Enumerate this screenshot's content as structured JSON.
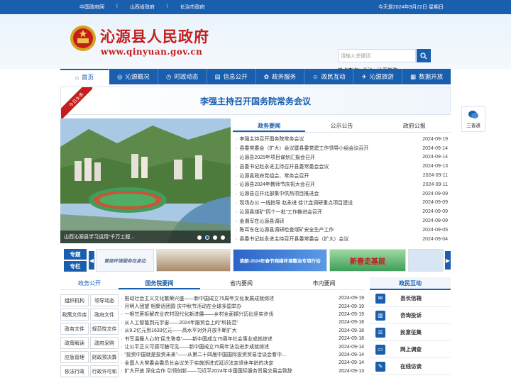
{
  "topbar": {
    "links": [
      "中国政府网",
      "山西省政府",
      "长治市政府"
    ],
    "separator": "|",
    "date": "今天是2024年9月22日 星期日"
  },
  "header": {
    "title": "沁源县人民政府",
    "url": "www.qinyuan.gov.cn",
    "search_placeholder": "请输入关键词",
    "hot_search": "热点查询：长治、沁源旅游"
  },
  "nav": {
    "items": [
      {
        "label": "首页",
        "icon": "home-icon"
      },
      {
        "label": "沁源概况",
        "icon": "globe-icon"
      },
      {
        "label": "时政动态",
        "icon": "clock-icon"
      },
      {
        "label": "信息公开",
        "icon": "doc-icon"
      },
      {
        "label": "政务服务",
        "icon": "service-icon"
      },
      {
        "label": "政民互动",
        "icon": "people-icon"
      },
      {
        "label": "沁源旅游",
        "icon": "travel-icon"
      },
      {
        "label": "数据开放",
        "icon": "data-icon"
      }
    ]
  },
  "headline": {
    "ribbon": "今日头条",
    "text": "李强主持召开国务院常务会议"
  },
  "slider": {
    "caption": "山西沁源县学习运用“千万工程..."
  },
  "news_tabs": [
    "政务要闻",
    "公示公告",
    "政府公报"
  ],
  "news": [
    {
      "title": "李强主持召开国务院常务会议",
      "date": "2024-09-19"
    },
    {
      "title": "县委常委会（扩大）会议暨县委党建工作领导小组会议召开",
      "date": "2024-09-14"
    },
    {
      "title": "沁源县2025年项目谋划汇报会召开",
      "date": "2024-09-14"
    },
    {
      "title": "县委书记赵永进主持召开县委常委会会议",
      "date": "2024-09-13"
    },
    {
      "title": "沁源县政府党组会、常务会召开",
      "date": "2024-09-11"
    },
    {
      "title": "沁源县2024年教师节庆祝大会召开",
      "date": "2024-09-11"
    },
    {
      "title": "沁源县召开北部集中供热项目推进会",
      "date": "2024-09-09"
    },
    {
      "title": "现场办公 一线指导 赵永进 徐计连调研重点项目建设",
      "date": "2024-09-09"
    },
    {
      "title": "沁源县煤矿“四个一批”工作推进会召开",
      "date": "2024-09-09"
    },
    {
      "title": "金湘军在沁源县调研",
      "date": "2024-09-09"
    },
    {
      "title": "陈耳东在沁源县调研检查煤矿安全生产工作",
      "date": "2024-09-05"
    },
    {
      "title": "县委书记赵永进主持召开县委常委会（扩大）会议",
      "date": "2024-09-04"
    }
  ],
  "side_float": {
    "label": "三晋通"
  },
  "banners": {
    "zt_labels": [
      "专",
      "题",
      "专",
      "栏"
    ],
    "prev": "◀",
    "next": "▶",
    "items": [
      "营商环境服务在身边",
      "",
      "清朗·2024年春节网络环境整治专项行动",
      "新春走基层",
      ""
    ]
  },
  "section_tabs": [
    "政务公开",
    "国务院要闻",
    "省内要闻",
    "市内要闻"
  ],
  "gov_grid": [
    [
      "组织机构",
      "领导动态"
    ],
    [
      "政策文件库",
      "政府文件"
    ],
    [
      "政务文件",
      "规范性文件"
    ],
    [
      "政策解读",
      "政府采购"
    ],
    [
      "应急管理",
      "财政预决算"
    ],
    [
      "依法行政",
      "行政许可和"
    ]
  ],
  "gov_news": [
    {
      "title": "推动社会主义文化繁荣兴盛——新中国成立75周年文化发展成就综述",
      "date": "2024-09-19"
    },
    {
      "title": "月明人团望 相聚话团圆 庆中秋节活动在全球多国举办",
      "date": "2024-09-19"
    },
    {
      "title": "一根甘蔗拆解农业农村现代化新进展——乡村全面振兴迈出坚实步伐",
      "date": "2024-09-19"
    },
    {
      "title": "从人工智能到元宇宙——2024年服贸会上的“科技范”",
      "date": "2024-09-18"
    },
    {
      "title": "从9.2亿元到1633亿元——高水平对外开放不断扩大",
      "date": "2024-09-18"
    },
    {
      "title": "书写温暖人心的“民生答卷”——新中国成立75周年社会事业成就综述",
      "date": "2024-09-18"
    },
    {
      "title": "让公平正义可感可触可见——新中国成立75周年法治进步成就综述",
      "date": "2024-09-14"
    },
    {
      "title": "“投资中国就是投资未来”——从第二十四届中国国际投资贸易洽谈会看中...",
      "date": "2024-09-14"
    },
    {
      "title": "全国人大常委会委员长会议关于实施渐进式延迟法定退休年龄的决定",
      "date": "2024-09-14"
    },
    {
      "title": "扩大开放 深化合作 引领创新——习近平2024年中国国际服务贸易交易会致辞",
      "date": "2024-09-13"
    }
  ],
  "interact": {
    "title": "政民互动",
    "items": [
      {
        "label": "县长信箱",
        "icon": "mail-icon"
      },
      {
        "label": "咨询投诉",
        "icon": "chart-icon"
      },
      {
        "label": "民意征集",
        "icon": "survey-icon"
      },
      {
        "label": "网上调查",
        "icon": "monitor-icon"
      },
      {
        "label": "在线访谈",
        "icon": "chat-icon"
      }
    ]
  }
}
